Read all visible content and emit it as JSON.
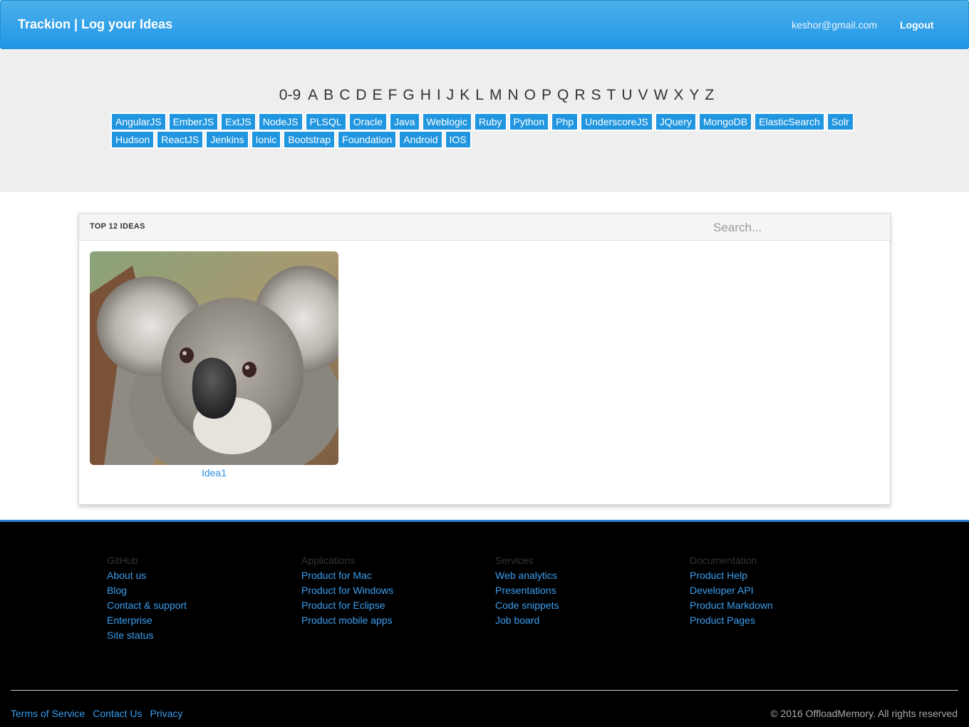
{
  "header": {
    "brand": "Trackion | Log your Ideas",
    "user_email": "keshor@gmail.com",
    "logout_label": "Logout"
  },
  "alphabet": [
    "0-9",
    "A",
    "B",
    "C",
    "D",
    "E",
    "F",
    "G",
    "H",
    "I",
    "J",
    "K",
    "L",
    "M",
    "N",
    "O",
    "P",
    "Q",
    "R",
    "S",
    "T",
    "U",
    "V",
    "W",
    "X",
    "Y",
    "Z"
  ],
  "tags": {
    "row1": [
      "AngularJS",
      "EmberJS",
      "ExtJS",
      "NodeJS",
      "PLSQL",
      "Oracle",
      "Java",
      "Weblogic",
      "Ruby",
      "Python",
      "Php",
      "UnderscoreJS",
      "JQuery",
      "MongoDB",
      "ElasticSearch",
      "Solr"
    ],
    "row2": [
      "Hudson",
      "ReactJS",
      "Jenkins",
      "Ionic",
      "Bootstrap",
      "Foundation",
      "Android",
      "IOS"
    ]
  },
  "panel": {
    "title": "TOP 12 IDEAS",
    "search_placeholder": "Search...",
    "ideas": [
      {
        "title": "Idea1",
        "image": "koala-photo"
      }
    ]
  },
  "footer": {
    "columns": [
      {
        "heading": "GitHub",
        "links": [
          "About us",
          "Blog",
          "Contact & support",
          "Enterprise",
          "Site status"
        ]
      },
      {
        "heading": "Applications",
        "links": [
          "Product for Mac",
          "Product for Windows",
          "Product for Eclipse",
          "Product mobile apps"
        ]
      },
      {
        "heading": "Services",
        "links": [
          "Web analytics",
          "Presentations",
          "Code snippets",
          "Job board"
        ]
      },
      {
        "heading": "Documentation",
        "links": [
          "Product Help",
          "Developer API",
          "Product Markdown",
          "Product Pages"
        ]
      }
    ],
    "bottom_links": [
      "Terms of Service",
      "Contact Us",
      "Privacy"
    ],
    "copyright": "© 2016 OffloadMemory. All rights reserved"
  },
  "colors": {
    "navbar": "#2196e8",
    "tag_bg": "#2196e0",
    "link": "#3a9ef0",
    "footer_bg": "#000000"
  }
}
